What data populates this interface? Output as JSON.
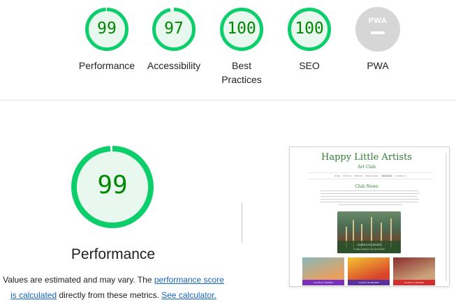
{
  "colors": {
    "pass": "#0cce6b",
    "pass_fill": "#e8f8ee",
    "pass_text": "#008800",
    "pwa_gray": "#d6d6d6",
    "link": "#1565c0"
  },
  "gauges": [
    {
      "label": "Performance",
      "score": "99",
      "ratio": 0.99
    },
    {
      "label": "Accessibility",
      "score": "97",
      "ratio": 0.97
    },
    {
      "label": "Best Practices",
      "score": "100",
      "ratio": 1.0
    },
    {
      "label": "SEO",
      "score": "100",
      "ratio": 1.0
    },
    {
      "label": "PWA",
      "badge": "PWA",
      "icon": "pwa-badge-icon"
    }
  ],
  "performance": {
    "score": "99",
    "ratio": 0.99,
    "title": "Performance",
    "note_start": "Values are estimated and may vary. The ",
    "note_link1": "performance score is calculated",
    "note_middle": " directly from these metrics. ",
    "note_link2": "See calculator."
  },
  "screenshot": {
    "site_title": "Happy Little Artists",
    "site_subtitle": "Art Club",
    "nav": [
      "Home",
      "About Us",
      "Members",
      "Book A Class",
      "Club News",
      "Contact Us"
    ],
    "active_nav": "Club News",
    "heading": "Club News",
    "hero_label": "CLASS 6-10 12/10/23",
    "hero_sublabel": "In paint ordering: Fine art brushes",
    "cards": [
      {
        "label": "CLASS 3-7 12/10/23",
        "band": "#7b2fbe",
        "top": "#86b8b8",
        "mid": "#e8a060"
      },
      {
        "label": "CLASS 9-10 06/10/23",
        "band": "#5a2fa0",
        "top": "#f4c430",
        "mid": "#d8452b"
      },
      {
        "label": "CLASS 3-7 03/10/23",
        "band": "#d32f2f",
        "top": "#8a2d2d",
        "mid": "#c9a27a"
      }
    ]
  }
}
